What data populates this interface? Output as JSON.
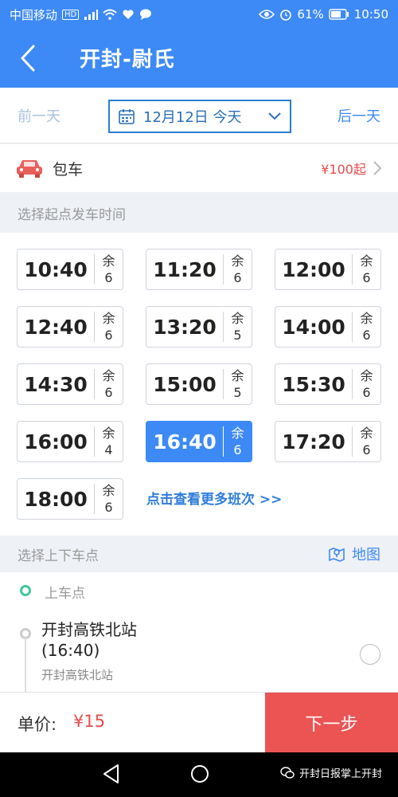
{
  "status_bar": {
    "carrier": "中国移动",
    "battery": "61%",
    "time": "10:50",
    "icons": [
      "hd-icon",
      "signal-icon",
      "wifi-icon",
      "heart-icon",
      "chat-icon",
      "eye-icon",
      "alarm-icon",
      "battery-icon"
    ]
  },
  "nav": {
    "title": "开封-尉氏",
    "back_icon": "back-arrow-icon"
  },
  "date_bar": {
    "prev": "前一天",
    "next": "后一天",
    "date": "12月12日 今天"
  },
  "charter": {
    "label": "包车",
    "price": "¥100起"
  },
  "sections": {
    "departure": "选择起点发车时间",
    "stops": "选择上下车点",
    "map": "地图"
  },
  "times": [
    {
      "time": "10:40",
      "rem_label": "余",
      "rem": "6"
    },
    {
      "time": "11:20",
      "rem_label": "余",
      "rem": "6"
    },
    {
      "time": "12:00",
      "rem_label": "余",
      "rem": "6"
    },
    {
      "time": "12:40",
      "rem_label": "余",
      "rem": "6"
    },
    {
      "time": "13:20",
      "rem_label": "余",
      "rem": "5"
    },
    {
      "time": "14:00",
      "rem_label": "余",
      "rem": "6"
    },
    {
      "time": "14:30",
      "rem_label": "余",
      "rem": "6"
    },
    {
      "time": "15:00",
      "rem_label": "余",
      "rem": "5"
    },
    {
      "time": "15:30",
      "rem_label": "余",
      "rem": "6"
    },
    {
      "time": "16:00",
      "rem_label": "余",
      "rem": "4"
    },
    {
      "time": "16:40",
      "rem_label": "余",
      "rem": "6",
      "selected": true
    },
    {
      "time": "17:20",
      "rem_label": "余",
      "rem": "6"
    },
    {
      "time": "18:00",
      "rem_label": "余",
      "rem": "6"
    }
  ],
  "more_link": "点击查看更多班次 >>",
  "stops": {
    "boarding_label": "上车点",
    "stop_name": "开封高铁北站",
    "stop_time": "(16:40)",
    "stop_sub": "开封高铁北站"
  },
  "bottom": {
    "price_label": "单价:",
    "price": "¥15",
    "next": "下一步"
  },
  "watermark": "开封日报掌上开封",
  "colors": {
    "primary": "#3d8af7",
    "accent_red": "#ec5454",
    "price_red": "#e84b4b",
    "green": "#3fc89a"
  }
}
